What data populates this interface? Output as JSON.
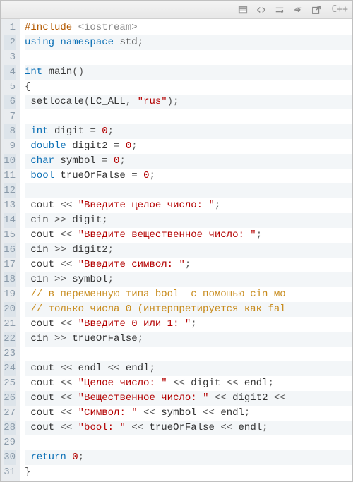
{
  "toolbar": {
    "language": "C++"
  },
  "code": {
    "lines": [
      {
        "n": 1,
        "tokens": [
          [
            "pp",
            "#include "
          ],
          [
            "inc",
            "<iostream>"
          ]
        ]
      },
      {
        "n": 2,
        "tokens": [
          [
            "kw",
            "using "
          ],
          [
            "kw",
            "namespace "
          ],
          [
            "id",
            "std"
          ],
          [
            "op",
            ";"
          ]
        ]
      },
      {
        "n": 3,
        "tokens": []
      },
      {
        "n": 4,
        "tokens": [
          [
            "kw",
            "int "
          ],
          [
            "fn",
            "main"
          ],
          [
            "op",
            "()"
          ]
        ]
      },
      {
        "n": 5,
        "tokens": [
          [
            "op",
            "{"
          ]
        ]
      },
      {
        "n": 6,
        "tokens": [
          [
            "id",
            " setlocale"
          ],
          [
            "op",
            "("
          ],
          [
            "id",
            "LC_ALL"
          ],
          [
            "op",
            ", "
          ],
          [
            "str",
            "\"rus\""
          ],
          [
            "op",
            ");"
          ]
        ]
      },
      {
        "n": 7,
        "tokens": []
      },
      {
        "n": 8,
        "tokens": [
          [
            "kw",
            " int "
          ],
          [
            "id",
            "digit "
          ],
          [
            "op",
            "= "
          ],
          [
            "num",
            "0"
          ],
          [
            "op",
            ";"
          ]
        ]
      },
      {
        "n": 9,
        "tokens": [
          [
            "kw",
            " double "
          ],
          [
            "id",
            "digit2 "
          ],
          [
            "op",
            "= "
          ],
          [
            "num",
            "0"
          ],
          [
            "op",
            ";"
          ]
        ]
      },
      {
        "n": 10,
        "tokens": [
          [
            "kw",
            " char "
          ],
          [
            "id",
            "symbol "
          ],
          [
            "op",
            "= "
          ],
          [
            "num",
            "0"
          ],
          [
            "op",
            ";"
          ]
        ]
      },
      {
        "n": 11,
        "tokens": [
          [
            "kw",
            " bool "
          ],
          [
            "id",
            "trueOrFalse "
          ],
          [
            "op",
            "= "
          ],
          [
            "num",
            "0"
          ],
          [
            "op",
            ";"
          ]
        ]
      },
      {
        "n": 12,
        "tokens": []
      },
      {
        "n": 13,
        "tokens": [
          [
            "id",
            " cout "
          ],
          [
            "op",
            "<< "
          ],
          [
            "str",
            "\"Введите целое число: \""
          ],
          [
            "op",
            ";"
          ]
        ]
      },
      {
        "n": 14,
        "tokens": [
          [
            "id",
            " cin "
          ],
          [
            "op",
            ">> "
          ],
          [
            "id",
            "digit"
          ],
          [
            "op",
            ";"
          ]
        ]
      },
      {
        "n": 15,
        "tokens": [
          [
            "id",
            " cout "
          ],
          [
            "op",
            "<< "
          ],
          [
            "str",
            "\"Введите вещественное число: \""
          ],
          [
            "op",
            ";"
          ]
        ]
      },
      {
        "n": 16,
        "tokens": [
          [
            "id",
            " cin "
          ],
          [
            "op",
            ">> "
          ],
          [
            "id",
            "digit2"
          ],
          [
            "op",
            ";"
          ]
        ]
      },
      {
        "n": 17,
        "tokens": [
          [
            "id",
            " cout "
          ],
          [
            "op",
            "<< "
          ],
          [
            "str",
            "\"Введите символ: \""
          ],
          [
            "op",
            ";"
          ]
        ]
      },
      {
        "n": 18,
        "tokens": [
          [
            "id",
            " cin "
          ],
          [
            "op",
            ">> "
          ],
          [
            "id",
            "symbol"
          ],
          [
            "op",
            ";"
          ]
        ]
      },
      {
        "n": 19,
        "tokens": [
          [
            "cmt",
            " // в переменную типа bool  с помощью cin мо"
          ]
        ]
      },
      {
        "n": 20,
        "tokens": [
          [
            "cmt",
            " // только числа 0 (интерпретируется как fal"
          ]
        ]
      },
      {
        "n": 21,
        "tokens": [
          [
            "id",
            " cout "
          ],
          [
            "op",
            "<< "
          ],
          [
            "str",
            "\"Введите 0 или 1: \""
          ],
          [
            "op",
            ";"
          ]
        ]
      },
      {
        "n": 22,
        "tokens": [
          [
            "id",
            " cin "
          ],
          [
            "op",
            ">> "
          ],
          [
            "id",
            "trueOrFalse"
          ],
          [
            "op",
            ";"
          ]
        ]
      },
      {
        "n": 23,
        "tokens": []
      },
      {
        "n": 24,
        "tokens": [
          [
            "id",
            " cout "
          ],
          [
            "op",
            "<< "
          ],
          [
            "id",
            "endl "
          ],
          [
            "op",
            "<< "
          ],
          [
            "id",
            "endl"
          ],
          [
            "op",
            ";"
          ]
        ]
      },
      {
        "n": 25,
        "tokens": [
          [
            "id",
            " cout "
          ],
          [
            "op",
            "<< "
          ],
          [
            "str",
            "\"Целое число: \" "
          ],
          [
            "op",
            "<< "
          ],
          [
            "id",
            "digit "
          ],
          [
            "op",
            "<< "
          ],
          [
            "id",
            "endl"
          ],
          [
            "op",
            ";"
          ]
        ]
      },
      {
        "n": 26,
        "tokens": [
          [
            "id",
            " cout "
          ],
          [
            "op",
            "<< "
          ],
          [
            "str",
            "\"Вещественное число: \" "
          ],
          [
            "op",
            "<< "
          ],
          [
            "id",
            "digit2 "
          ],
          [
            "op",
            "<<"
          ]
        ]
      },
      {
        "n": 27,
        "tokens": [
          [
            "id",
            " cout "
          ],
          [
            "op",
            "<< "
          ],
          [
            "str",
            "\"Символ: \" "
          ],
          [
            "op",
            "<< "
          ],
          [
            "id",
            "symbol "
          ],
          [
            "op",
            "<< "
          ],
          [
            "id",
            "endl"
          ],
          [
            "op",
            ";"
          ]
        ]
      },
      {
        "n": 28,
        "tokens": [
          [
            "id",
            " cout "
          ],
          [
            "op",
            "<< "
          ],
          [
            "str",
            "\"bool: \" "
          ],
          [
            "op",
            "<< "
          ],
          [
            "id",
            "trueOrFalse "
          ],
          [
            "op",
            "<< "
          ],
          [
            "id",
            "endl"
          ],
          [
            "op",
            ";"
          ]
        ]
      },
      {
        "n": 29,
        "tokens": []
      },
      {
        "n": 30,
        "tokens": [
          [
            "kw",
            " return "
          ],
          [
            "num",
            "0"
          ],
          [
            "op",
            ";"
          ]
        ]
      },
      {
        "n": 31,
        "tokens": [
          [
            "op",
            "}"
          ]
        ]
      }
    ]
  }
}
